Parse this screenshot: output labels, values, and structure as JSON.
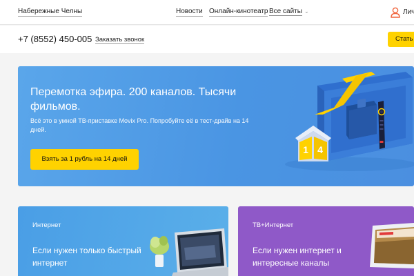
{
  "header": {
    "city": "Набережные Челны",
    "nav": [
      {
        "label": "Новости"
      },
      {
        "label": "Онлайн-кинотеатр"
      },
      {
        "label": "Все сайты"
      }
    ],
    "account_label": "Лич"
  },
  "contact": {
    "phone": "+7 (8552) 450-005",
    "callback_label": "Заказать звонок",
    "subscribe_button": "Стать"
  },
  "hero": {
    "title": "Перемотка эфира. 200 каналов. Тысячи фильмов.",
    "subtitle": "Всё это в умной ТВ-приставке Movix Pro. Попробуйте её в тест-драйв на 14 дней.",
    "button": "Взять за 1 рубль на 14 дней",
    "box_numbers": [
      "1",
      "4"
    ]
  },
  "cards": [
    {
      "tag": "Интернет",
      "title": "Если нужен только быстрый интернет"
    },
    {
      "tag": "ТВ+Интернет",
      "title": "Если нужен интернет и интересные каналы"
    }
  ],
  "colors": {
    "accent_yellow": "#ffd200",
    "hero_blue": "#4a95e3",
    "card_blue": "#4a9ee6",
    "card_purple": "#8f59c8",
    "icon_orange": "#f0623a"
  }
}
